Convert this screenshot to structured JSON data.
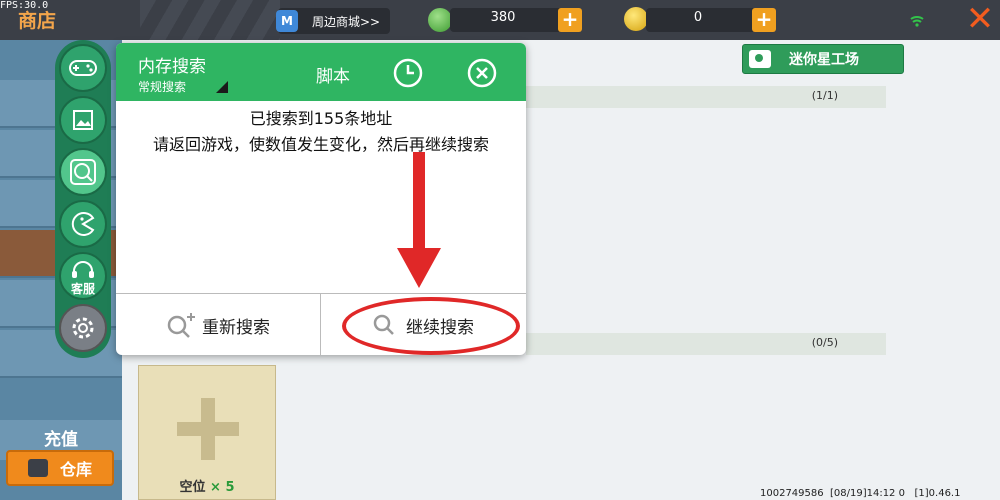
{
  "topbar": {
    "fps": "FPS:30.0",
    "title": "商店",
    "mall_label": "周边商城>>",
    "gems": "380",
    "coins": "0",
    "plus": "+"
  },
  "sidebar": {
    "recharge": "充值",
    "warehouse": "仓库"
  },
  "tools": {
    "service_label": "客服"
  },
  "mini_button": "迷你星工场",
  "sections": [
    {
      "count": "(1/1)"
    },
    {
      "count": "(0/5)"
    }
  ],
  "slot": {
    "label": "空位",
    "count": "× 5"
  },
  "dialog": {
    "title": "内存搜索",
    "mode": "常规搜索",
    "script": "脚本",
    "result": "已搜索到155条地址",
    "instruction": "请返回游戏，使数值发生变化，然后再继续搜索",
    "research_button": "重新搜索",
    "continue_button": "继续搜索"
  },
  "footer": "1002749586  [08/19]14:12 0   [1]0.46.1",
  "colors": {
    "accent_green": "#2fb562",
    "annotation_red": "#e02828",
    "orange": "#f08a1c"
  }
}
